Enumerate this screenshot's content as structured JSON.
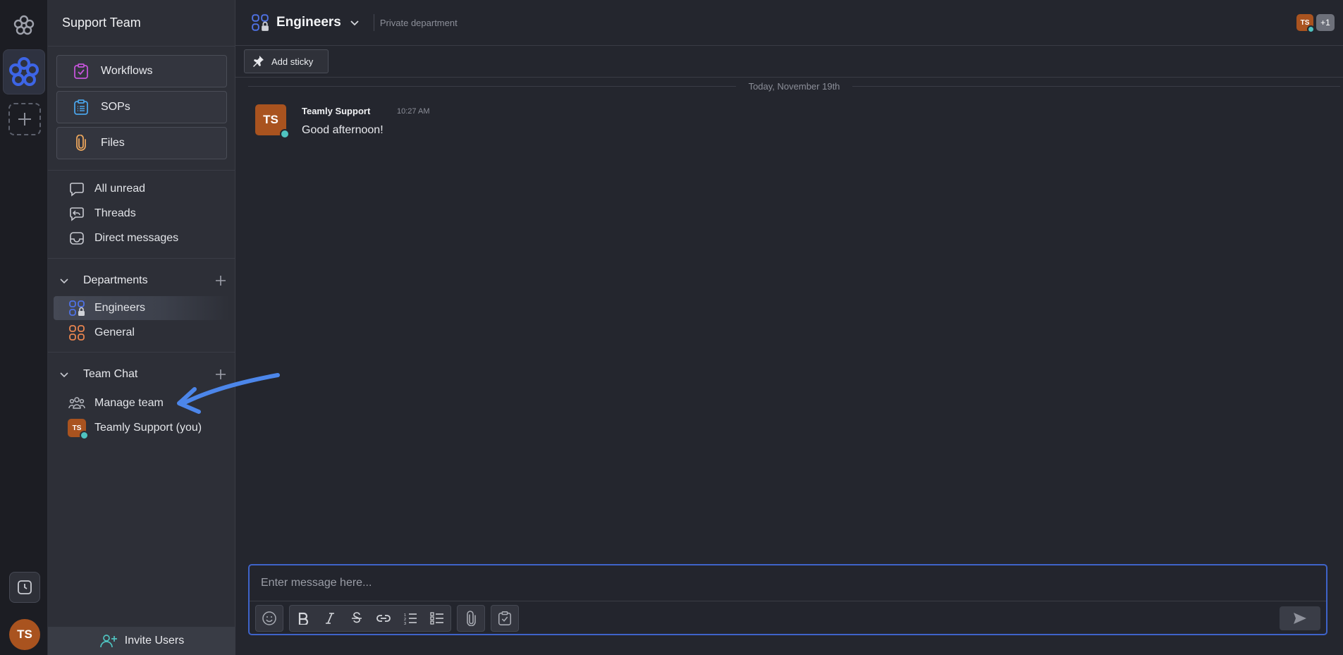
{
  "colors": {
    "accent": "#3e63c9",
    "brand_blue": "#3d65e6",
    "avatar_orange": "#a9531f",
    "online": "#4fc3c0",
    "annotation_arrow": "#4c86ea"
  },
  "rail": {
    "logo_icon": "teamly-flower-icon",
    "workspace_icon": "teamly-flower-icon",
    "add_workspace_icon": "plus-icon",
    "history_icon": "clock-icon",
    "me_initials": "TS"
  },
  "sidebar": {
    "team_name": "Support Team",
    "cards": [
      {
        "label": "Workflows",
        "icon": "clipboard-check-icon"
      },
      {
        "label": "SOPs",
        "icon": "clipboard-list-icon"
      },
      {
        "label": "Files",
        "icon": "paperclip-icon"
      }
    ],
    "nav": [
      {
        "label": "All unread",
        "icon": "speech-bubble-icon"
      },
      {
        "label": "Threads",
        "icon": "threads-icon"
      },
      {
        "label": "Direct messages",
        "icon": "inbox-icon"
      }
    ],
    "departments": {
      "title": "Departments",
      "items": [
        {
          "label": "Engineers",
          "icon": "private-department-icon",
          "active": true
        },
        {
          "label": "General",
          "icon": "department-icon",
          "active": false
        }
      ]
    },
    "team_chat": {
      "title": "Team Chat",
      "items": [
        {
          "label": "Manage team",
          "icon": "team-icon"
        },
        {
          "label": "Teamly Support (you)",
          "avatar_initials": "TS"
        }
      ]
    },
    "invite_label": "Invite Users"
  },
  "header": {
    "department": "Engineers",
    "visibility": "Private department",
    "member_initials": "TS",
    "extra_members": "+1"
  },
  "toolbar": {
    "add_sticky": "Add sticky"
  },
  "feed": {
    "date_divider": "Today, November 19th",
    "messages": [
      {
        "author": "Teamly Support",
        "time": "10:27 AM",
        "text": "Good afternoon!",
        "initials": "TS"
      }
    ]
  },
  "composer": {
    "placeholder": "Enter message here...",
    "tools": [
      "emoji-icon",
      "bold-icon",
      "italic-icon",
      "strikethrough-icon",
      "link-icon",
      "numbered-list-icon",
      "bullet-list-icon",
      "attach-icon",
      "task-icon",
      "send-icon"
    ]
  }
}
